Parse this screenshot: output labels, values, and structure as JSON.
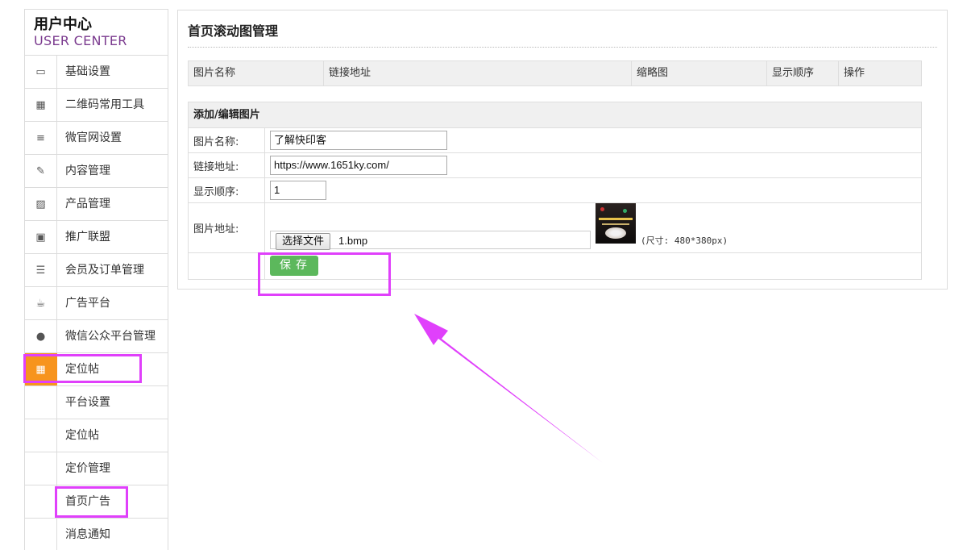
{
  "sidebar": {
    "title": "用户中心",
    "subtitle": "USER CENTER",
    "items": [
      {
        "icon": "monitor-icon",
        "glyph": "▭",
        "label": "基础设置"
      },
      {
        "icon": "qrcode-icon",
        "glyph": "▦",
        "label": "二维码常用工具"
      },
      {
        "icon": "list-icon",
        "glyph": "≡",
        "label": "微官网设置"
      },
      {
        "icon": "edit-icon",
        "glyph": "✎",
        "label": "内容管理"
      },
      {
        "icon": "image-icon",
        "glyph": "▨",
        "label": "产品管理"
      },
      {
        "icon": "gift-icon",
        "glyph": "▣",
        "label": "推广联盟"
      },
      {
        "icon": "database-icon",
        "glyph": "☰",
        "label": "会员及订单管理"
      },
      {
        "icon": "coffee-icon",
        "glyph": "☕",
        "label": "广告平台"
      },
      {
        "icon": "comments-icon",
        "glyph": "●",
        "label": "微信公众平台管理"
      },
      {
        "icon": "qrcode-icon",
        "glyph": "▦",
        "label": "定位帖"
      }
    ],
    "sub_items": [
      "平台设置",
      "定位帖",
      "定价管理",
      "首页广告",
      "消息通知"
    ]
  },
  "main": {
    "title": "首页滚动图管理",
    "list_columns": [
      "图片名称",
      "链接地址",
      "缩略图",
      "显示顺序",
      "操作"
    ],
    "form": {
      "heading": "添加/编辑图片",
      "name_label": "图片名称:",
      "name_value": "了解快印客",
      "link_label": "链接地址:",
      "link_value": "https://www.1651ky.com/",
      "order_label": "显示顺序:",
      "order_value": "1",
      "image_label": "图片地址:",
      "file_button": "选择文件",
      "file_name": "1.bmp",
      "size_note": "(尺寸: 480*380px)",
      "save_label": "保存"
    }
  },
  "colors": {
    "accent_active": "#f7941d",
    "highlight": "#e040fb",
    "save_button": "#5cb85c",
    "brand_subtitle": "#7b3b8f"
  }
}
